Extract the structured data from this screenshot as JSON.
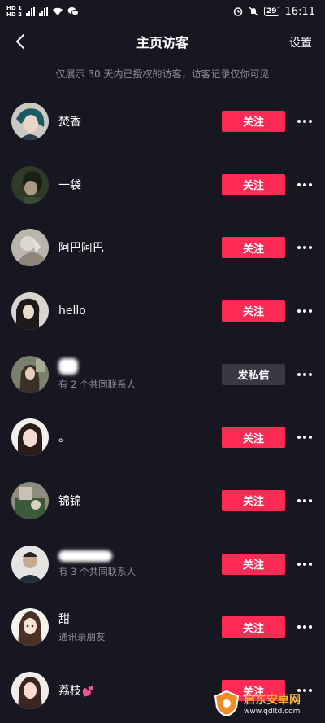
{
  "status_bar": {
    "hd_top": "HD 1",
    "hd_bottom": "HD 2",
    "battery": "29",
    "time": "16:11"
  },
  "header": {
    "title": "主页访客",
    "settings_label": "设置",
    "notice": "仅展示 30 天内已授权的访客，访客记录仅你可见"
  },
  "visitors": [
    {
      "name": "焚香",
      "subtitle": "",
      "action": "关注"
    },
    {
      "name": "一袋",
      "subtitle": "",
      "action": "关注"
    },
    {
      "name": "阿巴阿巴",
      "subtitle": "",
      "action": "关注"
    },
    {
      "name": "hello",
      "subtitle": "",
      "action": "关注"
    },
    {
      "name": "",
      "subtitle": "有 2 个共同联系人",
      "action": "发私信"
    },
    {
      "name": "。",
      "subtitle": "",
      "action": "关注"
    },
    {
      "name": "锦锦",
      "subtitle": "",
      "action": "关注"
    },
    {
      "name": "",
      "subtitle": "有 3 个共同联系人",
      "action": "关注"
    },
    {
      "name": "甜",
      "subtitle": "通讯录朋友",
      "action": "关注"
    },
    {
      "name": "荔枝",
      "subtitle": "",
      "action": "关注"
    }
  ],
  "watermark": {
    "cn": "启东安卓网",
    "url": "www.qdltd.com"
  },
  "colors": {
    "background": "#171722",
    "follow_button": "#fe2c55",
    "message_button": "#393945",
    "muted_text": "#8b8b95"
  }
}
